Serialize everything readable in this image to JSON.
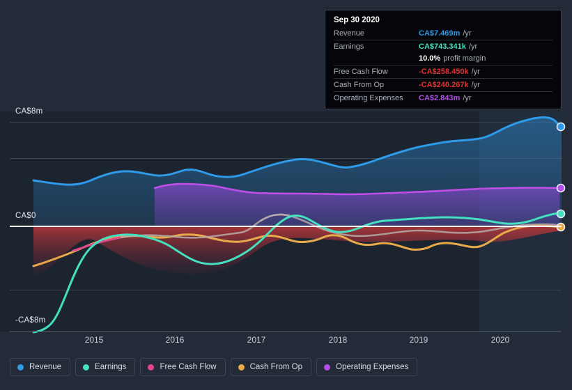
{
  "tooltip": {
    "date": "Sep 30 2020",
    "rows": [
      {
        "label": "Revenue",
        "value": "CA$7.469m",
        "unit": "/yr",
        "color": "#2f9ae8"
      },
      {
        "label": "Earnings",
        "value": "CA$743.341k",
        "unit": "/yr",
        "color": "#45e0c0"
      },
      {
        "label": "",
        "value": "10.0%",
        "unit": "profit margin",
        "color": "#ffffff"
      },
      {
        "label": "Free Cash Flow",
        "value": "-CA$258.450k",
        "unit": "/yr",
        "color": "#e8302f"
      },
      {
        "label": "Cash From Op",
        "value": "-CA$240.267k",
        "unit": "/yr",
        "color": "#e8302f"
      },
      {
        "label": "Operating Expenses",
        "value": "CA$2.843m",
        "unit": "/yr",
        "color": "#b14fe8"
      }
    ]
  },
  "legend": [
    {
      "label": "Revenue",
      "color": "#2f9ae8"
    },
    {
      "label": "Earnings",
      "color": "#45e0c0"
    },
    {
      "label": "Free Cash Flow",
      "color": "#e0468a"
    },
    {
      "label": "Cash From Op",
      "color": "#e8a94a"
    },
    {
      "label": "Operating Expenses",
      "color": "#b14fe8"
    }
  ],
  "axes": {
    "y_labels": [
      "CA$8m",
      "CA$0",
      "-CA$8m"
    ],
    "x_labels": [
      "2015",
      "2016",
      "2017",
      "2018",
      "2019",
      "2020"
    ]
  },
  "chart_data": {
    "type": "area",
    "title": "",
    "xlabel": "",
    "ylabel": "CA$",
    "ylim": [
      -8,
      8
    ],
    "y_ticks": [
      8,
      0,
      -8
    ],
    "grid": true,
    "legend_position": "bottom-left",
    "currency": "CA$",
    "units": "millions",
    "x": [
      "2014.3",
      "2014.5",
      "2014.75",
      "2015",
      "2015.25",
      "2015.5",
      "2015.75",
      "2016",
      "2016.25",
      "2016.5",
      "2016.75",
      "2017",
      "2017.25",
      "2017.5",
      "2017.75",
      "2018",
      "2018.25",
      "2018.5",
      "2018.75",
      "2019",
      "2019.25",
      "2019.5",
      "2019.75",
      "2020",
      "2020.25",
      "2020.5",
      "2020.75"
    ],
    "x_tick_labels": [
      "2015",
      "2016",
      "2017",
      "2018",
      "2019",
      "2020"
    ],
    "series": [
      {
        "name": "Revenue",
        "color": "#2f9ae8",
        "fill": true,
        "values": [
          3.52,
          3.45,
          3.38,
          3.46,
          3.62,
          3.72,
          3.68,
          3.7,
          3.88,
          3.98,
          3.85,
          3.66,
          3.74,
          3.9,
          4.13,
          4.05,
          3.86,
          3.94,
          4.22,
          4.52,
          4.74,
          4.92,
          5.02,
          5.1,
          5.92,
          6.42,
          7.469
        ]
      },
      {
        "name": "Earnings",
        "color": "#45e0c0",
        "fill": false,
        "values": [
          -8.1,
          -7.95,
          -6.6,
          -3.6,
          -1.7,
          -0.92,
          -0.74,
          -0.77,
          -0.92,
          -1.46,
          -1.82,
          -1.85,
          -1.55,
          -1.35,
          -0.9,
          -0.22,
          0.38,
          0.12,
          -0.06,
          0.02,
          0.3,
          0.46,
          0.52,
          0.36,
          0.42,
          0.32,
          0.743
        ]
      },
      {
        "name": "Free Cash Flow",
        "color": "#e0468a",
        "fill": false,
        "values": [
          null,
          null,
          -1.92,
          -1.72,
          -1.4,
          -1.05,
          -0.74,
          -0.58,
          -0.62,
          -0.7,
          -0.68,
          -0.6,
          -0.4,
          0.12,
          0.46,
          0.3,
          0.16,
          0.06,
          0.0,
          -0.04,
          0.0,
          -0.02,
          -0.05,
          -0.06,
          0.02,
          -0.1,
          -0.258
        ]
      },
      {
        "name": "Cash From Op",
        "color": "#e8a94a",
        "fill": false,
        "values": [
          -2.62,
          -2.32,
          -1.95,
          -1.58,
          -1.28,
          -1.05,
          -0.9,
          -0.85,
          -0.7,
          -0.62,
          -0.7,
          -0.8,
          -0.88,
          -0.72,
          -0.55,
          -0.7,
          -0.88,
          -0.7,
          -0.52,
          -0.62,
          -0.92,
          -0.78,
          -0.8,
          -0.92,
          -0.6,
          -0.24,
          -0.24
        ]
      },
      {
        "name": "Operating Expenses",
        "color": "#b14fe8",
        "fill": true,
        "values": [
          null,
          null,
          null,
          null,
          null,
          null,
          2.95,
          3.05,
          2.96,
          2.7,
          2.66,
          2.64,
          2.62,
          2.62,
          2.64,
          2.66,
          2.6,
          2.62,
          2.64,
          2.66,
          2.68,
          2.7,
          2.74,
          2.8,
          2.84,
          2.86,
          2.843
        ]
      }
    ],
    "highlight": {
      "date": "Sep 30 2020",
      "x": "2020.75"
    }
  }
}
